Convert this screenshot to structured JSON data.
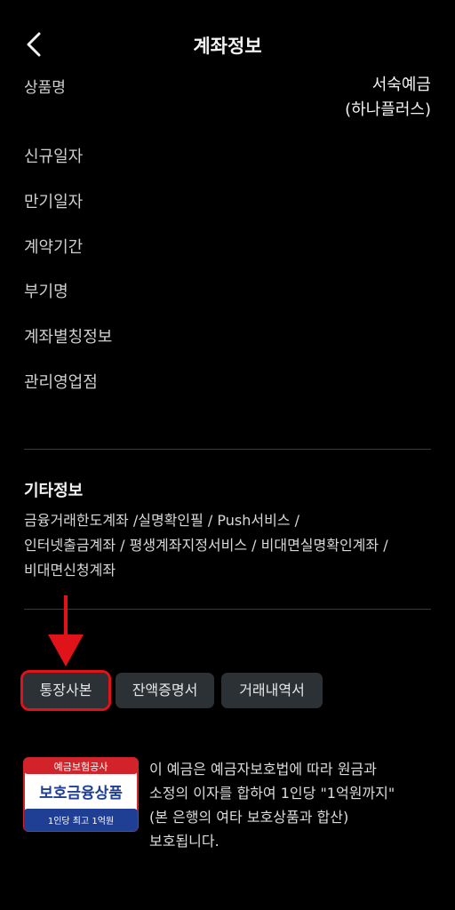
{
  "header": {
    "title": "계좌정보"
  },
  "account": {
    "product_label": "상품명",
    "product_value_line1": "서숙예금",
    "product_value_line2": "(하나플러스)",
    "fields": [
      "신규일자",
      "만기일자",
      "계약기간",
      "부기명",
      "계좌별칭정보",
      "관리영업점"
    ]
  },
  "etc": {
    "title": "기타정보",
    "line1": "금융거래한도계좌 /실명확인필 / Push서비스 /",
    "line2": "인터넷출금계좌 / 평생계좌지정서비스 / 비대면실명확인계좌 /",
    "line3": "비대면신청계좌"
  },
  "buttons": {
    "passbook": "통장사본",
    "balance_cert": "잔액증명서",
    "transaction_history": "거래내역서"
  },
  "badge": {
    "top": "예금보험공사",
    "main": "보호금융상품",
    "bottom": "1인당 최고 1억원"
  },
  "protection": {
    "line1": "이 예금은 예금자보호법에 따라 원금과",
    "line2": "소정의 이자를 합하여 1인당 \"1억원까지\"",
    "line3": "(본 은행의 여타 보호상품과 합산)",
    "line4": "보호됩니다."
  },
  "colors": {
    "background": "#000000",
    "button_bg": "#2c3136",
    "highlight_red": "#e0131a",
    "badge_blue": "#1f3f95",
    "badge_red": "#d2232a"
  },
  "icons": {
    "back": "chevron-left-icon",
    "arrow": "arrow-down-icon"
  }
}
